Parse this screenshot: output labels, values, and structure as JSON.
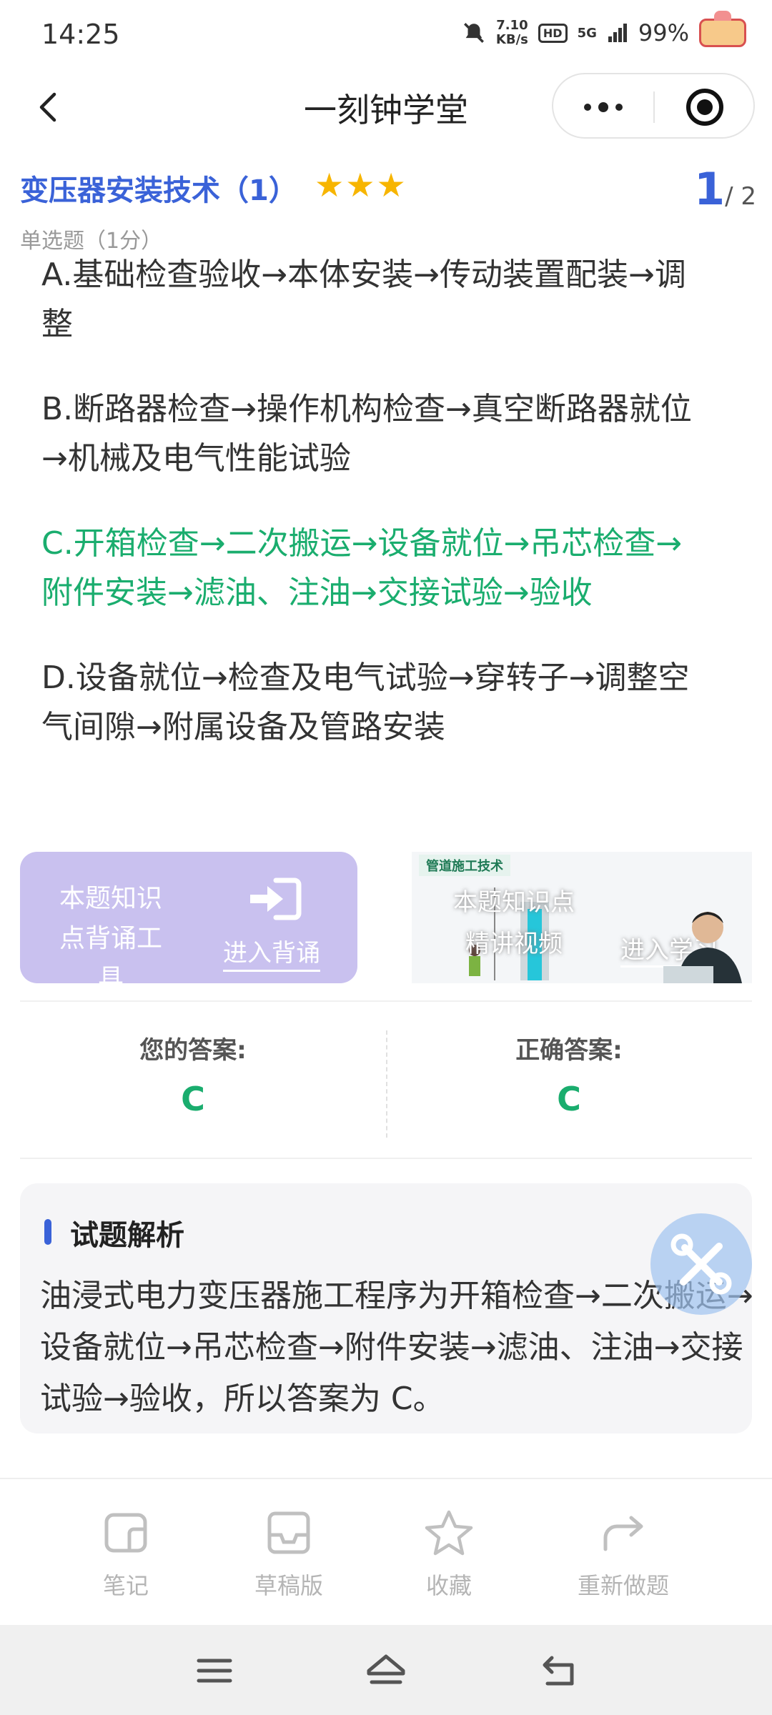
{
  "status_bar": {
    "time": "14:25",
    "speed_value": "7.10",
    "speed_unit": "KB/s",
    "hd": "HD",
    "network": "5G",
    "battery": "99%"
  },
  "nav": {
    "title": "一刻钟学堂"
  },
  "question": {
    "title": "变压器安装技术（1）",
    "stars": "★★★",
    "page_current": "1",
    "page_total": "/ 2",
    "type": "单选题（1分）",
    "options": [
      {
        "text": "A.基础检查验收→本体安装→传动装置配装→调整",
        "correct": false
      },
      {
        "text": "B.断路器检查→操作机构检查→真空断路器就位→机械及电气性能试验",
        "correct": false
      },
      {
        "text": "C.开箱检查→二次搬运→设备就位→吊芯检查→附件安装→滤油、注油→交接试验→验收",
        "correct": true
      },
      {
        "text": "D.设备就位→检查及电气试验→穿转子→调整空气间隙→附属设备及管路安装",
        "correct": false
      }
    ]
  },
  "tools": {
    "recite_text": "本题知识点背诵工具",
    "recite_link": "进入背诵",
    "video_tag": "管道施工技术",
    "video_text": "本题知识点精讲视频",
    "video_link": "进入学习"
  },
  "answers": {
    "your_label": "您的答案:",
    "your_value": "C",
    "correct_label": "正确答案:",
    "correct_value": "C"
  },
  "analysis": {
    "title": "试题解析",
    "text": "油浸式电力变压器施工程序为开箱检查→二次搬运→设备就位→吊芯检查→附件安装→滤油、注油→交接试验→验收，所以答案为 C。"
  },
  "toolbar": {
    "notes": "笔记",
    "draft": "草稿版",
    "favorite": "收藏",
    "redo": "重新做题"
  },
  "colors": {
    "accent": "#3a62d8",
    "correct": "#1aad6e",
    "star": "#f7b500",
    "recite_card": "#c9c1ef"
  }
}
